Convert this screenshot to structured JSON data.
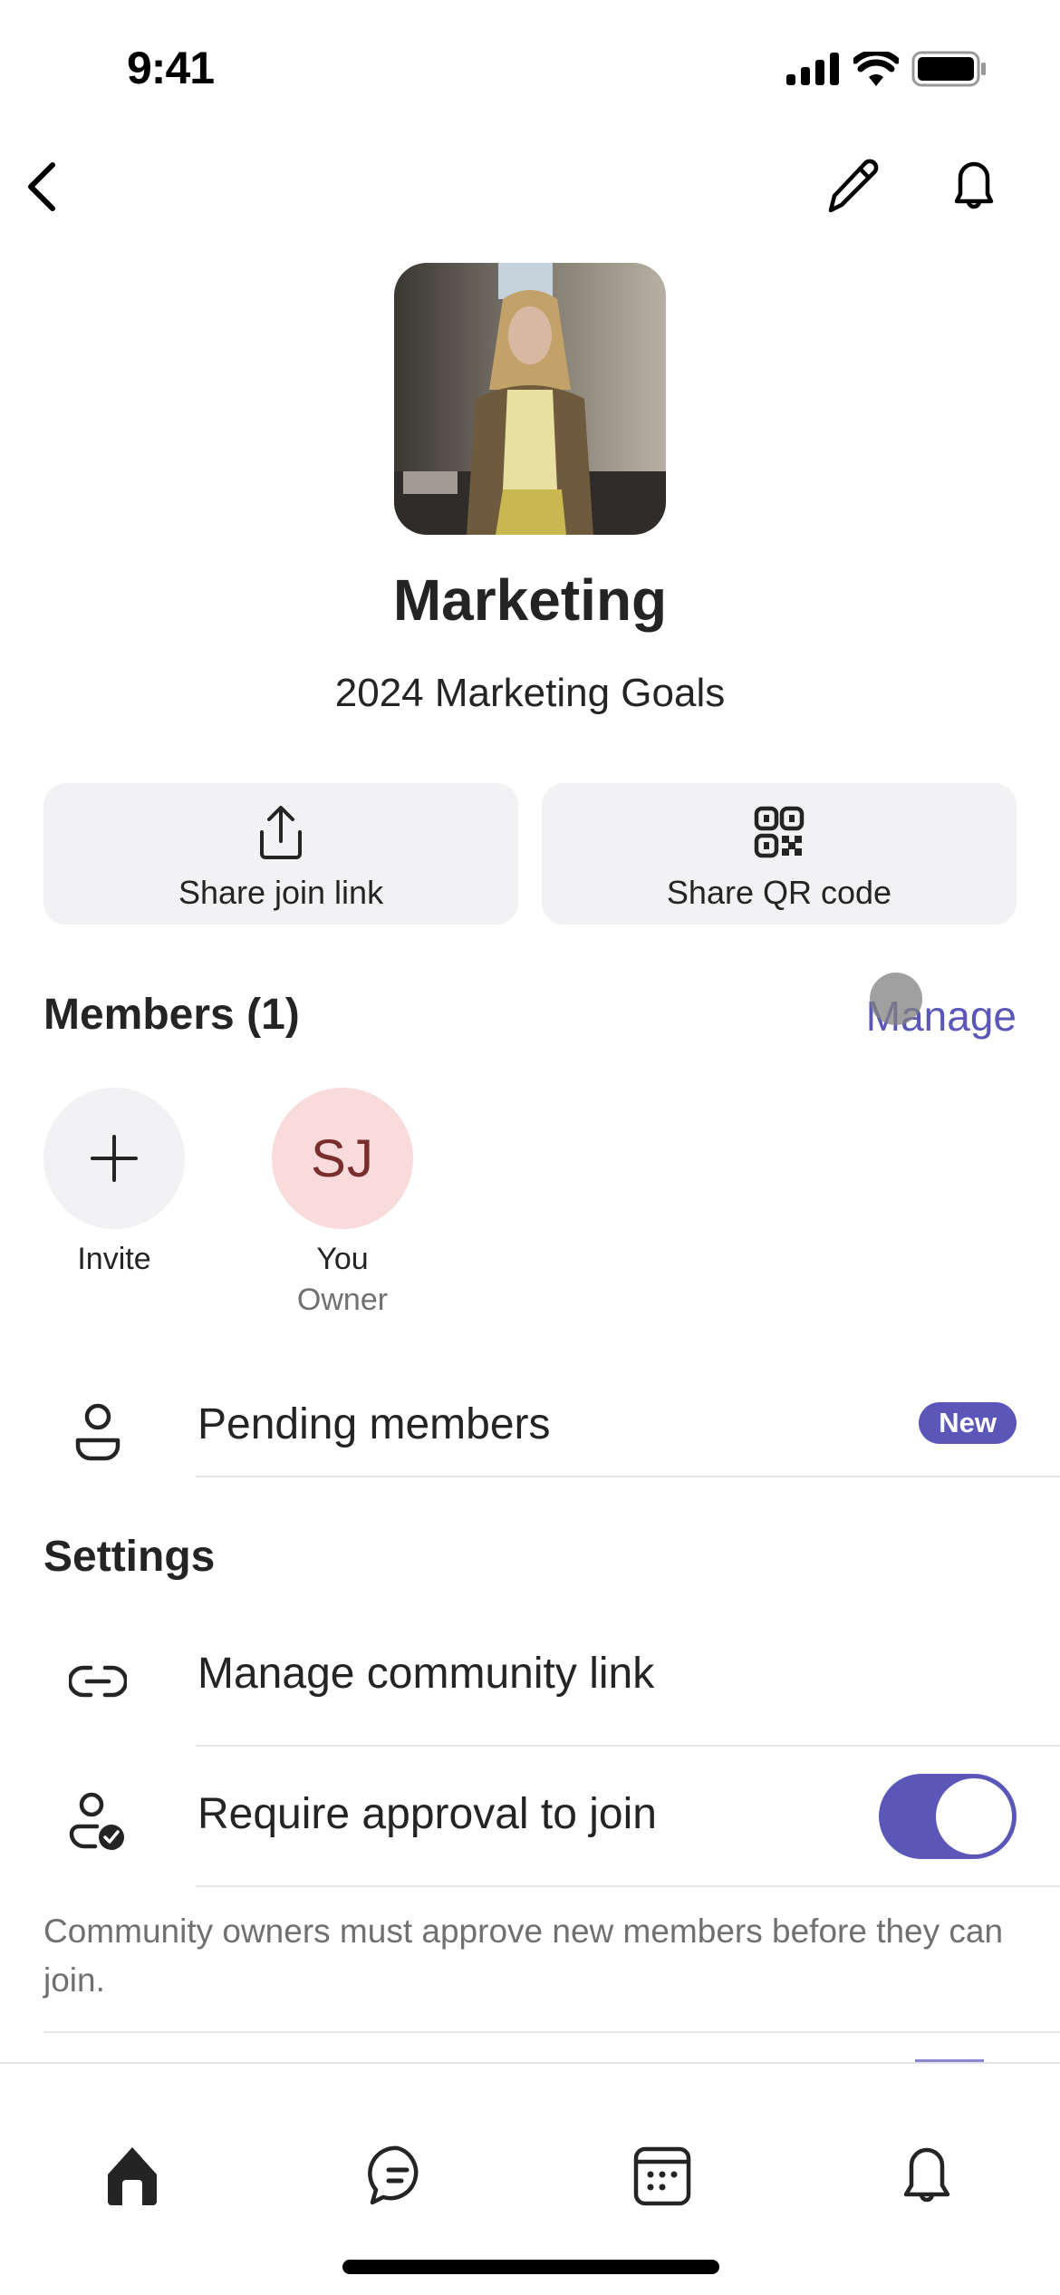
{
  "status_bar": {
    "time": "9:41",
    "icons": [
      "cellular-signal-icon",
      "wifi-icon",
      "battery-icon"
    ]
  },
  "nav": {
    "back_icon": "chevron-left-icon",
    "edit_icon": "pencil-icon",
    "notifications_icon": "bell-icon"
  },
  "community": {
    "image_alt": "Community photo",
    "name": "Marketing",
    "description": "2024 Marketing Goals"
  },
  "share_actions": [
    {
      "label": "Share join link",
      "icon": "share-icon"
    },
    {
      "label": "Share QR code",
      "icon": "qr-code-icon"
    }
  ],
  "members": {
    "title": "Members (1)",
    "manage_label": "Manage",
    "invite": {
      "label": "Invite",
      "icon": "plus-icon"
    },
    "list": [
      {
        "initials": "SJ",
        "name": "You",
        "role": "Owner"
      }
    ]
  },
  "pending": {
    "label": "Pending members",
    "badge": "New"
  },
  "settings": {
    "title": "Settings",
    "items": [
      {
        "label": "Manage community link",
        "icon": "link-icon"
      },
      {
        "label": "Require approval to join",
        "icon": "person-check-icon",
        "toggle_on": true
      }
    ],
    "approval_note": "Community owners must approve new members before they can join."
  },
  "tab_bar": {
    "tabs": [
      {
        "name": "Home",
        "icon": "home-icon",
        "active": true
      },
      {
        "name": "Chat",
        "icon": "chat-icon",
        "active": false
      },
      {
        "name": "Calendar",
        "icon": "calendar-icon",
        "active": false
      },
      {
        "name": "Activity",
        "icon": "bell-icon",
        "active": false
      }
    ]
  },
  "colors": {
    "accent": "#5b57b8",
    "avatar_bg": "#f9dbdb",
    "avatar_text": "#7a2d2d",
    "button_bg": "#f2f1f4",
    "text_primary": "#242424",
    "text_secondary": "#707070"
  }
}
